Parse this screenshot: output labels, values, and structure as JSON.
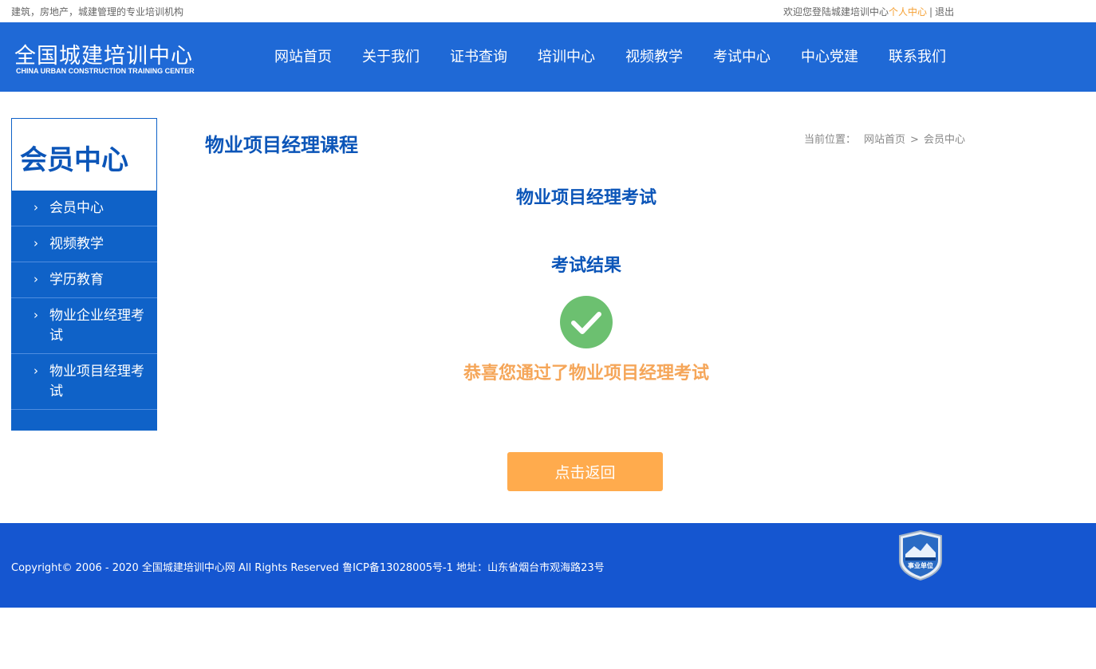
{
  "topbar": {
    "slogan": "建筑，房地产，城建管理的专业培训机构",
    "welcome": "欢迎您登陆城建培训中心",
    "personal_center": "个人中心",
    "separator": "|",
    "logout": "退出"
  },
  "header": {
    "logo_cn": "全国城建培训中心",
    "logo_en": "CHINA URBAN CONSTRUCTION TRAINING CENTER",
    "nav": [
      {
        "label": "网站首页"
      },
      {
        "label": "关于我们"
      },
      {
        "label": "证书查询"
      },
      {
        "label": "培训中心"
      },
      {
        "label": "视频教学"
      },
      {
        "label": "考试中心"
      },
      {
        "label": "中心党建"
      },
      {
        "label": "联系我们"
      }
    ]
  },
  "sidebar": {
    "title": "会员中心",
    "items": [
      {
        "label": "会员中心"
      },
      {
        "label": "视频教学"
      },
      {
        "label": "学历教育"
      },
      {
        "label": "物业企业经理考试"
      },
      {
        "label": "物业项目经理考试"
      }
    ],
    "chevron": "›"
  },
  "main": {
    "heading": "物业项目经理课程",
    "breadcrumb": {
      "label": "当前位置：",
      "home": "网站首页",
      "separator": ">",
      "current": "会员中心"
    },
    "exam_title": "物业项目经理考试",
    "result_title": "考试结果",
    "result_icon": "check-circle-icon",
    "congrats": "恭喜您通过了物业项目经理考试",
    "back_button": "点击返回"
  },
  "footer": {
    "copyright": "Copyright© 2006 - 2020 全国城建培训中心网 All Rights Reserved 鲁ICP备13028005号-1 地址：山东省烟台市观海路23号",
    "badge_text": "事业单位"
  },
  "colors": {
    "header_blue": "#1f69d6",
    "sidebar_blue": "#0f62c8",
    "heading_blue": "#0b55b8",
    "accent_orange": "#f5a033",
    "success_green": "#6cc070",
    "footer_blue": "#1556d0"
  }
}
